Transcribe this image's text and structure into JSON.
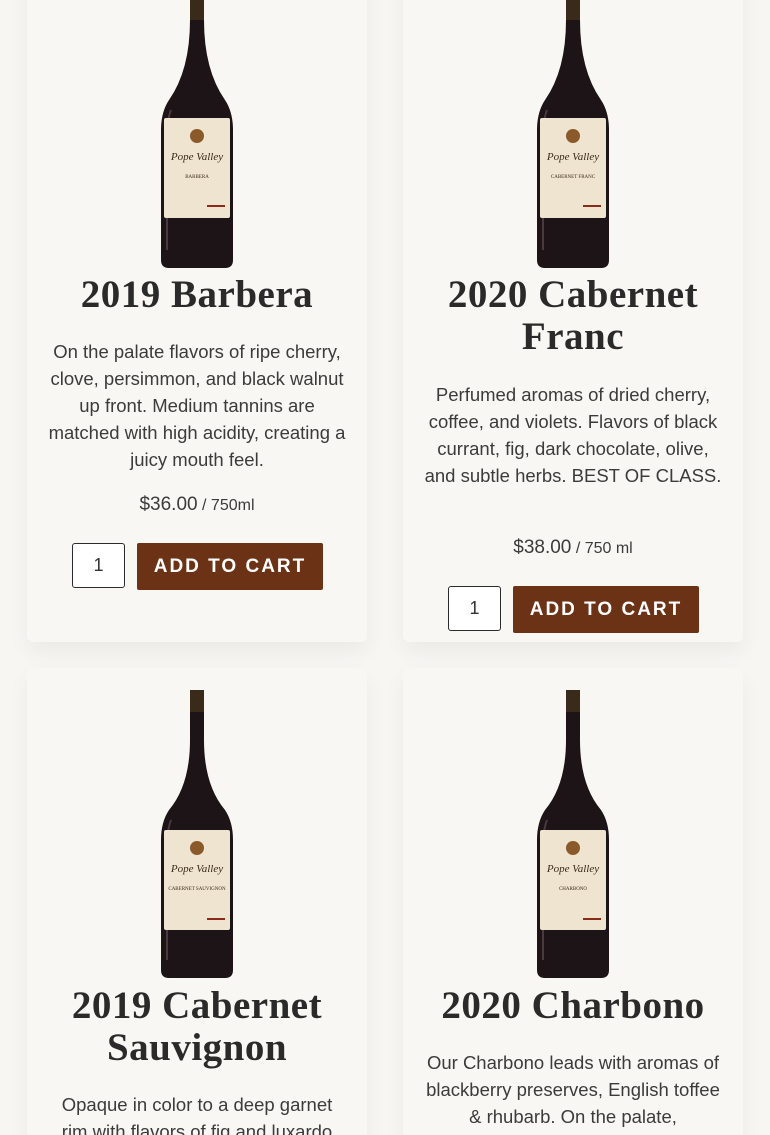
{
  "products": [
    {
      "title": "2019 Barbera",
      "label_text": "BARBERA",
      "description": "On the palate flavors of ripe cherry, clove, persimmon, and black walnut up front. Medium tannins are matched with high acidity, creating a juicy mouth feel.",
      "price": "$36.00",
      "unit": " / 750ml",
      "quantity": "1",
      "button_label": "ADD TO CART"
    },
    {
      "title": "2020 Cabernet Franc",
      "label_text": "CABERNET FRANC",
      "description": "Perfumed aromas of dried cherry, coffee, and violets. Flavors of black currant, fig, dark chocolate, olive, and subtle herbs. BEST OF CLASS.",
      "price": "$38.00",
      "unit": " / 750 ml",
      "quantity": "1",
      "button_label": "ADD TO CART"
    },
    {
      "title": "2019 Cabernet Sauvignon",
      "label_text": "CABERNET SAUVIGNON",
      "description": "Opaque in color to a deep garnet rim with flavors of fig and luxardo"
    },
    {
      "title": "2020 Charbono",
      "label_text": "CHARBONO",
      "description": "Our Charbono leads with aromas of blackberry preserves, English toffee & rhubarb. On the palate,"
    }
  ],
  "brand_script": "Pope Valley",
  "colors": {
    "button_bg": "#6b3216",
    "page_bg": "#f8f6f3",
    "bottle": "#1c1416",
    "label": "#efe4cf"
  }
}
